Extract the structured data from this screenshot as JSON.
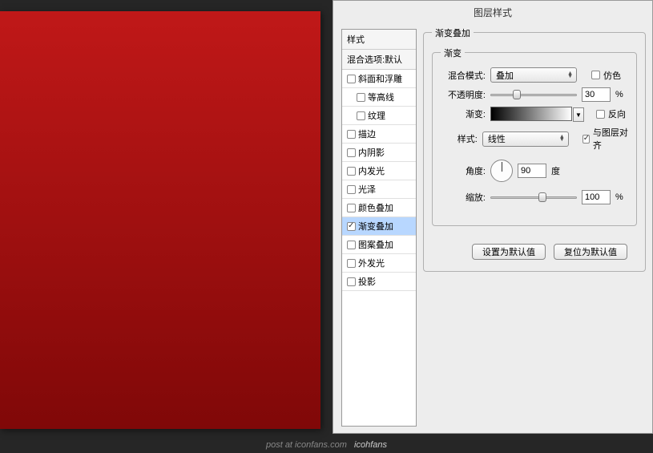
{
  "dialog": {
    "title": "图层样式"
  },
  "styles": {
    "header": "样式",
    "blendDefault": "混合选项:默认",
    "items": [
      {
        "label": "斜面和浮雕",
        "checked": false
      },
      {
        "label": "等高线",
        "checked": false,
        "indent": 1
      },
      {
        "label": "纹理",
        "checked": false,
        "indent": 1
      },
      {
        "label": "描边",
        "checked": false
      },
      {
        "label": "内阴影",
        "checked": false
      },
      {
        "label": "内发光",
        "checked": false
      },
      {
        "label": "光泽",
        "checked": false
      },
      {
        "label": "颜色叠加",
        "checked": false
      },
      {
        "label": "渐变叠加",
        "checked": true,
        "selected": true
      },
      {
        "label": "图案叠加",
        "checked": false
      },
      {
        "label": "外发光",
        "checked": false
      },
      {
        "label": "投影",
        "checked": false
      }
    ]
  },
  "panel": {
    "outerLegend": "渐变叠加",
    "innerLegend": "渐变",
    "blendModeLabel": "混合模式:",
    "blendModeValue": "叠加",
    "ditherLabel": "仿色",
    "opacityLabel": "不透明度:",
    "opacityValue": "30",
    "opacityUnit": "%",
    "gradientLabel": "渐变:",
    "reverseLabel": "反向",
    "styleLabel": "样式:",
    "styleValue": "线性",
    "alignLabel": "与图层对齐",
    "angleLabel": "角度:",
    "angleValue": "90",
    "angleUnit": "度",
    "scaleLabel": "缩放:",
    "scaleValue": "100",
    "scaleUnit": "%",
    "setDefault": "设置为默认值",
    "resetDefault": "复位为默认值"
  },
  "footer": {
    "prefix": "post at ",
    "site": "iconfans.com",
    "brand": "icohfans"
  }
}
